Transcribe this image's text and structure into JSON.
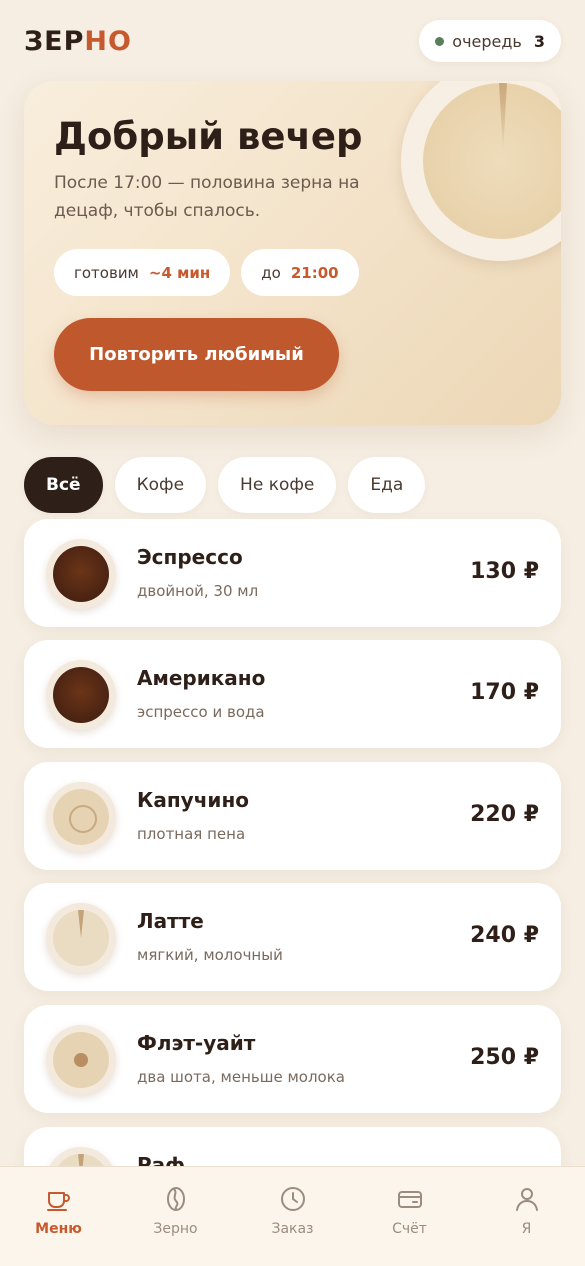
{
  "header": {
    "logo_part1": "ЗЕР",
    "logo_part2": "НО",
    "queue_label": "очередь",
    "queue_count": "3"
  },
  "hero": {
    "title": "Добрый вечер",
    "subtitle": "После 17:00 — половина зерна на децаф, чтобы спалось.",
    "chip1_label": "готовим",
    "chip1_value": "~4 мин",
    "chip2_label": "до",
    "chip2_value": "21:00",
    "button_label": "Повторить любимый"
  },
  "tabs": [
    {
      "label": "Всё"
    },
    {
      "label": "Кофе"
    },
    {
      "label": "Не кофе"
    },
    {
      "label": "Еда"
    }
  ],
  "menu": [
    {
      "name": "Эспрессо",
      "desc": "двойной, 30 мл",
      "price": "130 ₽",
      "cup": "dark"
    },
    {
      "name": "Американо",
      "desc": "эспрессо и вода",
      "price": "170 ₽",
      "cup": "dark"
    },
    {
      "name": "Капучино",
      "desc": "плотная пена",
      "price": "220 ₽",
      "cup": "cap"
    },
    {
      "name": "Латте",
      "desc": "мягкий, молочный",
      "price": "240 ₽",
      "cup": "latte"
    },
    {
      "name": "Флэт-уайт",
      "desc": "два шота, меньше молока",
      "price": "250 ₽",
      "cup": "flat"
    },
    {
      "name": "Раф",
      "desc": "",
      "price": "",
      "cup": "latte"
    }
  ],
  "nav": [
    {
      "label": "Меню",
      "icon": "cup-icon"
    },
    {
      "label": "Зерно",
      "icon": "bean-icon"
    },
    {
      "label": "Заказ",
      "icon": "clock-icon"
    },
    {
      "label": "Счёт",
      "icon": "wallet-icon"
    },
    {
      "label": "Я",
      "icon": "user-icon"
    }
  ],
  "colors": {
    "accent": "#c65a2e",
    "dark": "#2e1f18",
    "background": "#f6eee3"
  }
}
